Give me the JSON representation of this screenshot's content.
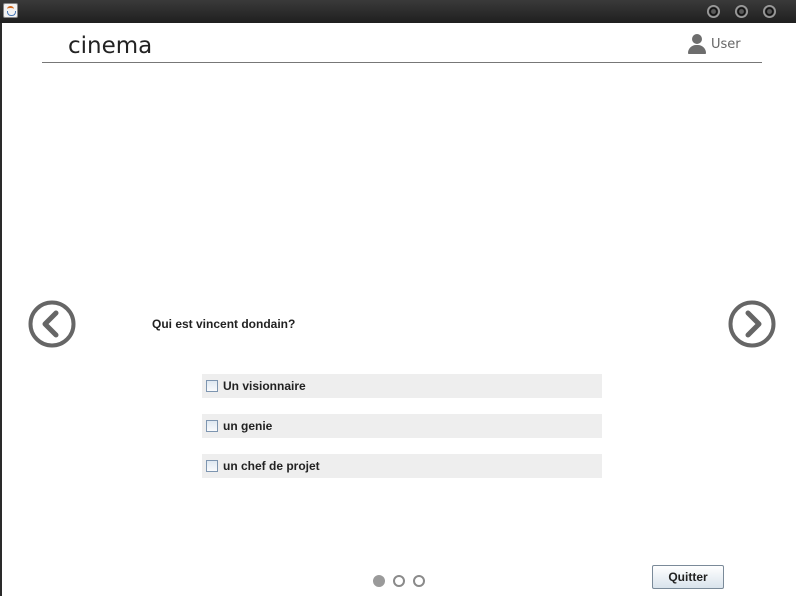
{
  "window": {
    "app_icon": "java-icon",
    "controls": [
      "minimize-icon",
      "maximize-icon",
      "close-icon"
    ]
  },
  "header": {
    "title": "cinema",
    "user_label": "User",
    "user_icon": "user-icon"
  },
  "navigation": {
    "prev_icon": "chevron-left-circle-icon",
    "next_icon": "chevron-right-circle-icon",
    "color": "#666666"
  },
  "quiz": {
    "question": "Qui est vincent dondain?",
    "options": [
      {
        "label": "Un visionnaire",
        "checked": false
      },
      {
        "label": "un genie",
        "checked": false
      },
      {
        "label": "un chef de projet",
        "checked": false
      }
    ]
  },
  "pagination": {
    "total": 3,
    "current": 1
  },
  "footer": {
    "quit_label": "Quitter"
  }
}
